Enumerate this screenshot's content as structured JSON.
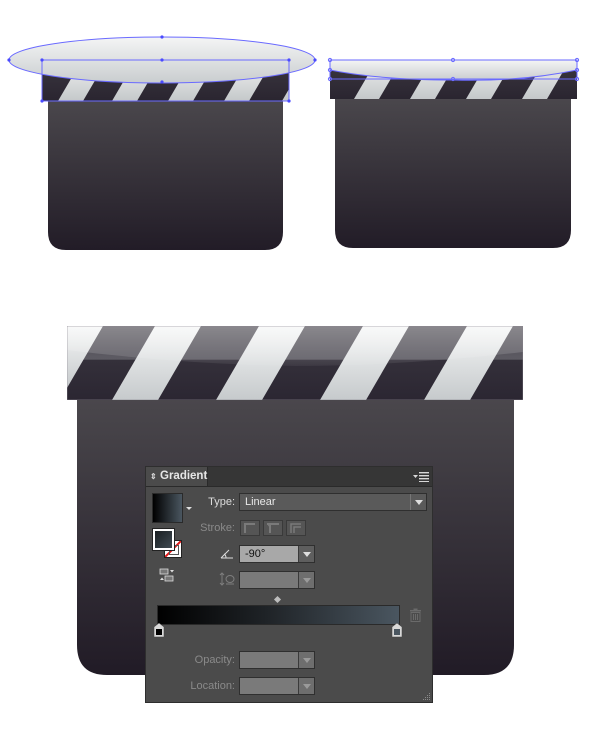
{
  "artwork": {
    "clapper_top_left": {
      "name": "clapperboard-step-1",
      "selected_shape": "ellipse"
    },
    "clapper_top_right": {
      "name": "clapperboard-step-2",
      "selected_shape": "curved-shape"
    },
    "clapper_main": {
      "name": "clapperboard-result"
    },
    "colors": {
      "board_top": "#4a474c",
      "board_bottom": "#221c27",
      "stripe_dark": "#2d2830",
      "stripe_light": "#d9dbdc",
      "highlight": "#eceeef",
      "selection": "#6666ff"
    }
  },
  "gradient_panel": {
    "title": "Gradient",
    "title_icon": "up-down-arrows-icon",
    "menu_icon": "panel-menu-icon",
    "type_label": "Type:",
    "type_value": "Linear",
    "stroke_label": "Stroke:",
    "angle_icon": "angle-icon",
    "angle_value": "-90°",
    "aspect_icon": "aspect-ratio-icon",
    "aspect_value": "",
    "opacity_label": "Opacity:",
    "opacity_value": "",
    "location_label": "Location:",
    "location_value": "",
    "gradient_colors": {
      "start": "#000000",
      "end": "#4a5660"
    },
    "stops": [
      {
        "location_percent": 0,
        "color": "#000000"
      },
      {
        "location_percent": 100,
        "color": "#4a5660"
      }
    ],
    "midpoint_percent": 50,
    "icons": {
      "swatch": "gradient-swatch-icon",
      "fill_stroke": "fill-stroke-icon",
      "reverse": "reverse-gradient-icon",
      "trash": "delete-stop-icon",
      "resize": "resize-grip-icon"
    }
  }
}
